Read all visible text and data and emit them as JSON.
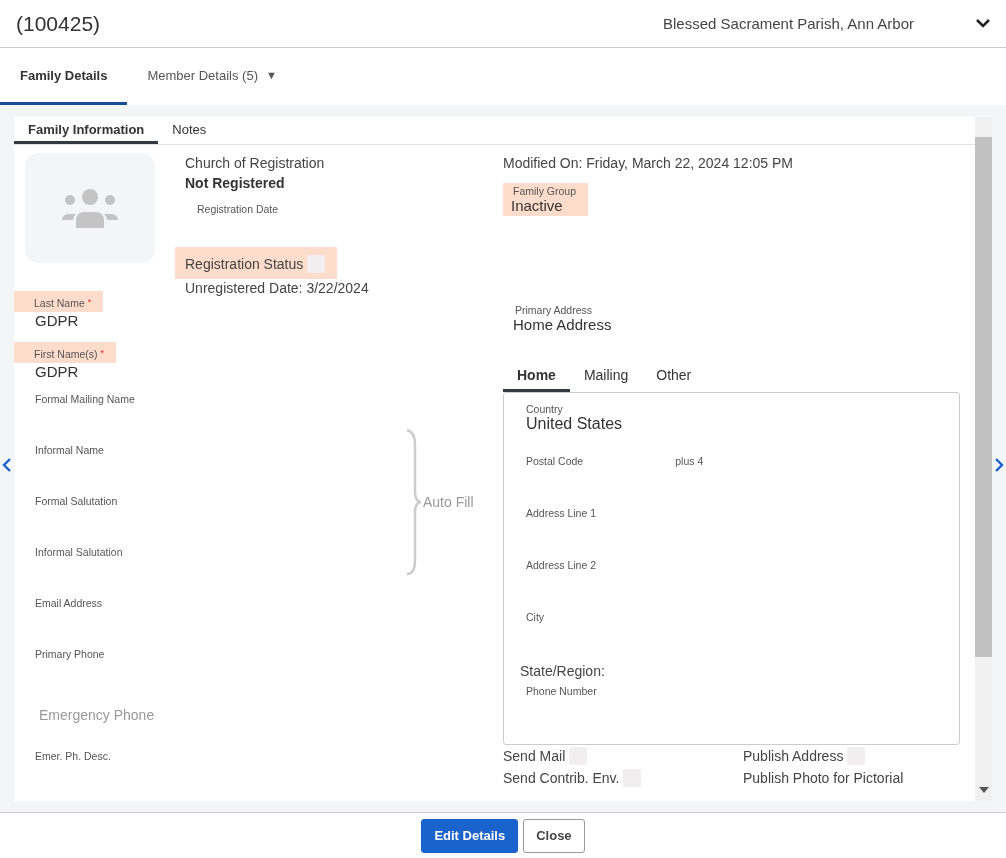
{
  "header": {
    "title": "(100425)",
    "parish": "Blessed Sacrament Parish, Ann Arbor"
  },
  "tabs": [
    {
      "label": "Family Details",
      "selected": true
    },
    {
      "label": "Member Details (5)",
      "selected": false,
      "caret": "▼"
    }
  ],
  "subtabs": [
    {
      "label": "Family Information",
      "selected": true
    },
    {
      "label": "Notes",
      "selected": false
    }
  ],
  "left_fields": [
    {
      "kind": "field",
      "label": "Last Name",
      "required": "*",
      "highlighted": true,
      "value": "GDPR"
    },
    {
      "kind": "field",
      "label": "First Name(s)",
      "required": "*",
      "highlighted": true,
      "value": "GDPR"
    },
    {
      "kind": "field",
      "label": "Formal Mailing Name",
      "required": false,
      "highlighted": false
    },
    {
      "kind": "field",
      "label": "Informal Name",
      "required": false,
      "highlighted": false
    },
    {
      "kind": "field",
      "label": "Formal Salutation",
      "required": false,
      "highlighted": false
    },
    {
      "kind": "field",
      "label": "Informal Salutation",
      "required": false,
      "highlighted": false
    },
    {
      "kind": "field",
      "label": "Email Address",
      "required": false,
      "highlighted": false
    },
    {
      "kind": "field",
      "label": "Primary Phone",
      "required": false,
      "highlighted": false
    },
    {
      "kind": "heading",
      "label": "Emergency Phone"
    },
    {
      "kind": "field",
      "label": "Emer. Ph. Desc.",
      "required": false,
      "highlighted": false
    }
  ],
  "registration": {
    "church_label": "Church of Registration",
    "church_value": "Not Registered",
    "date_label": "Registration Date",
    "status_label": "Registration Status",
    "status_highlighted": true,
    "status_checked": false,
    "unregistered": "Unregistered Date: 3/22/2024"
  },
  "auto_fill": "Auto Fill",
  "modified": "Modified On: Friday, March 22, 2024 12:05 PM",
  "family_group": {
    "label": "Family Group",
    "value": "Inactive",
    "highlighted": true
  },
  "primary_address": {
    "label": "Primary Address",
    "value": "Home Address"
  },
  "address_tabs": [
    {
      "label": "Home",
      "selected": true
    },
    {
      "label": "Mailing",
      "selected": false
    },
    {
      "label": "Other",
      "selected": false
    }
  ],
  "address_fields": [
    {
      "kind": "field",
      "label": "Country",
      "value": "United States"
    },
    {
      "kind": "field",
      "label": "Postal Code",
      "extra": "plus 4"
    },
    {
      "kind": "field",
      "label": "Address Line 1"
    },
    {
      "kind": "field",
      "label": "Address Line 2"
    },
    {
      "kind": "field",
      "label": "City"
    },
    {
      "kind": "heading",
      "label": "State/Region:"
    },
    {
      "kind": "field",
      "label": "Phone Number"
    }
  ],
  "options": [
    {
      "kind": "checkbox",
      "label": "Send Mail",
      "checked": false
    },
    {
      "kind": "checkbox",
      "label": "Publish Address",
      "checked": false
    },
    {
      "kind": "checkbox",
      "label": "Send Contrib. Env.",
      "checked": false
    },
    {
      "kind": "text",
      "label": "Publish Photo for Pictorial"
    }
  ],
  "buttons": [
    {
      "label": "Edit Details",
      "kind": "primary"
    },
    {
      "label": "Close",
      "kind": "secondary"
    }
  ]
}
